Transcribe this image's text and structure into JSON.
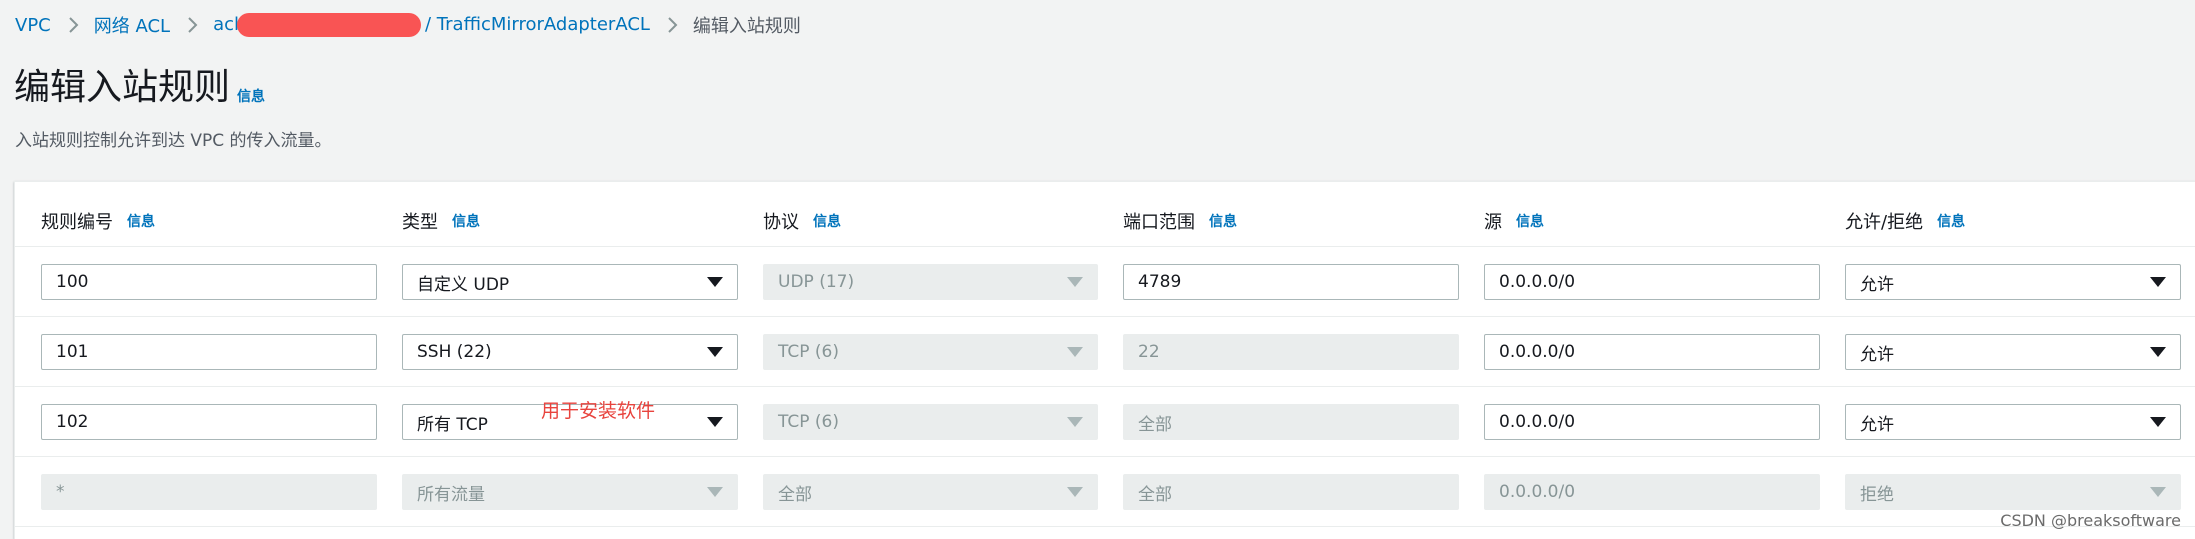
{
  "breadcrumb": {
    "vpc": "VPC",
    "network_acl": "网络 ACL",
    "acl_prefix": "acl",
    "acl_suffix": "/ TrafficMirrorAdapterACL",
    "current": "编辑入站规则"
  },
  "header": {
    "title": "编辑入站规则",
    "info": "信息",
    "description": "入站规则控制允许到达 VPC 的传入流量。"
  },
  "columns": [
    {
      "label": "规则编号",
      "info": "信息"
    },
    {
      "label": "类型",
      "info": "信息"
    },
    {
      "label": "协议",
      "info": "信息"
    },
    {
      "label": "端口范围",
      "info": "信息"
    },
    {
      "label": "源",
      "info": "信息"
    },
    {
      "label": "允许/拒绝",
      "info": "信息"
    }
  ],
  "rows": [
    {
      "rule_number": "100",
      "type": "自定义 UDP",
      "protocol": "UDP (17)",
      "port_range": "4789",
      "source": "0.0.0.0/0",
      "action": "允许"
    },
    {
      "rule_number": "101",
      "type": "SSH (22)",
      "protocol": "TCP (6)",
      "port_range": "22",
      "source": "0.0.0.0/0",
      "action": "允许"
    },
    {
      "rule_number": "102",
      "type": "所有 TCP",
      "protocol": "TCP (6)",
      "port_range": "全部",
      "source": "0.0.0.0/0",
      "action": "允许"
    },
    {
      "rule_number": "*",
      "type": "所有流量",
      "protocol": "全部",
      "port_range": "全部",
      "source": "0.0.0.0/0",
      "action": "拒绝"
    }
  ],
  "annotation": "用于安装软件",
  "watermark": "CSDN @breaksoftware",
  "colors": {
    "link": "#0073bb",
    "annotation": "#e8433d",
    "redaction": "#f95454"
  }
}
